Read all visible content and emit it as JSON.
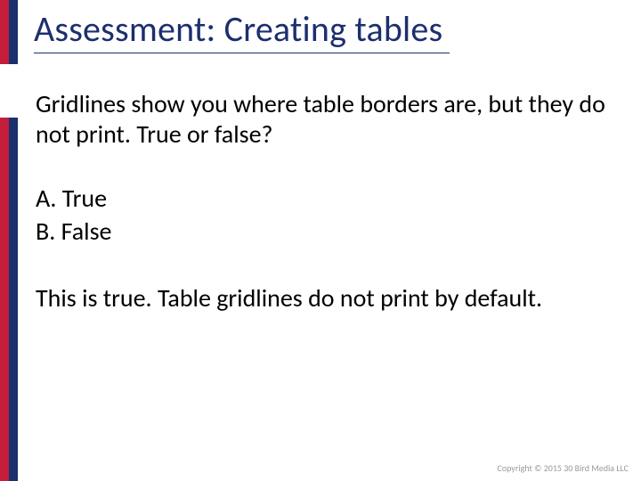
{
  "title": "Assessment: Creating tables",
  "question": "Gridlines show you where table borders are, but they do not print. True or false?",
  "options": {
    "a": "A. True",
    "b": "B. False"
  },
  "answer": "This is true. Table gridlines do not print by default.",
  "copyright": "Copyright © 2015 30 Bird Media LLC",
  "colors": {
    "accent_red": "#c41e3a",
    "accent_blue": "#1c2f6e"
  }
}
